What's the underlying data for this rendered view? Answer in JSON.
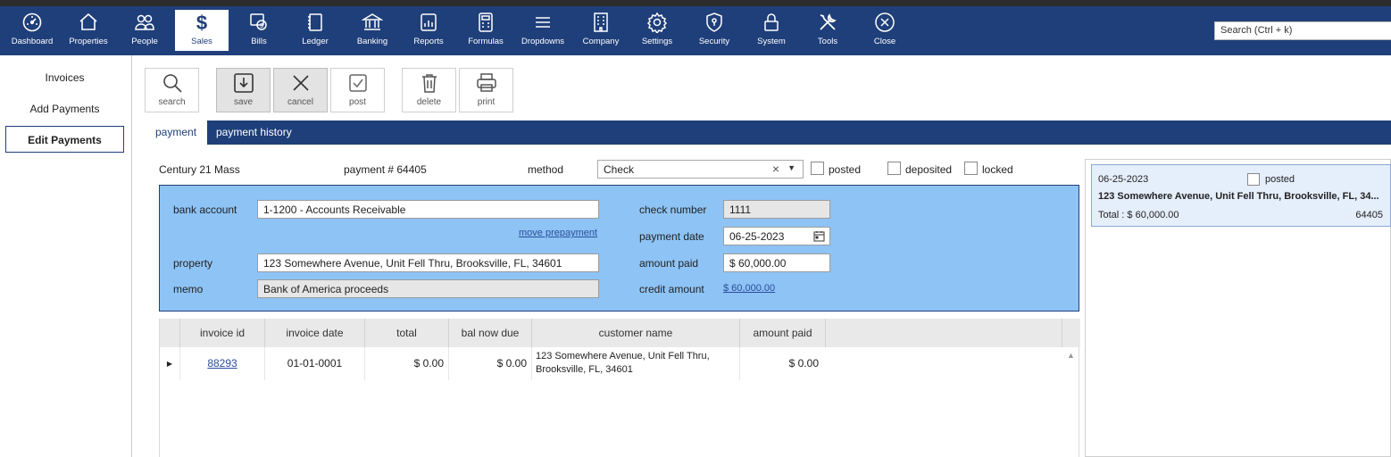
{
  "nav": {
    "items": [
      {
        "label": "Dashboard"
      },
      {
        "label": "Properties"
      },
      {
        "label": "People"
      },
      {
        "label": "Sales"
      },
      {
        "label": "Bills"
      },
      {
        "label": "Ledger"
      },
      {
        "label": "Banking"
      },
      {
        "label": "Reports"
      },
      {
        "label": "Formulas"
      },
      {
        "label": "Dropdowns"
      },
      {
        "label": "Company"
      },
      {
        "label": "Settings"
      },
      {
        "label": "Security"
      },
      {
        "label": "System"
      },
      {
        "label": "Tools"
      },
      {
        "label": "Close"
      }
    ],
    "active": "Sales",
    "search_placeholder": "Search (Ctrl + k)"
  },
  "sidebar": {
    "items": [
      {
        "label": "Invoices"
      },
      {
        "label": "Add Payments"
      },
      {
        "label": "Edit Payments"
      }
    ],
    "active": "Edit Payments"
  },
  "toolbar": {
    "search": "search",
    "save": "save",
    "cancel": "cancel",
    "post": "post",
    "delete": "delete",
    "print": "print"
  },
  "tabs": [
    {
      "label": "payment"
    },
    {
      "label": "payment history"
    }
  ],
  "header": {
    "company": "Century 21 Mass",
    "payment_number": "payment # 64405",
    "method_label": "method",
    "method_value": "Check",
    "posted_label": "posted",
    "deposited_label": "deposited",
    "locked_label": "locked"
  },
  "form": {
    "bank_account_label": "bank account",
    "bank_account_value": "1-1200 - Accounts Receivable",
    "move_prepayment": "move prepayment",
    "property_label": "property",
    "property_value": "123 Somewhere Avenue, Unit Fell Thru, Brooksville, FL, 34601",
    "memo_label": "memo",
    "memo_value": "Bank of America proceeds",
    "check_number_label": "check number",
    "check_number_value": "1111",
    "payment_date_label": "payment date",
    "payment_date_value": "06-25-2023",
    "amount_paid_label": "amount paid",
    "amount_paid_value": "$ 60,000.00",
    "credit_amount_label": "credit amount",
    "credit_amount_value": "$ 60,000.00"
  },
  "grid": {
    "columns": [
      "invoice id",
      "invoice date",
      "total",
      "bal now due",
      "customer name",
      "amount paid"
    ],
    "rows": [
      {
        "invoice_id": "88293",
        "invoice_date": "01-01-0001",
        "total": "$ 0.00",
        "bal_now_due": "$ 0.00",
        "customer_name_line1": "123 Somewhere Avenue, Unit Fell Thru,",
        "customer_name_line2": "Brooksville, FL, 34601",
        "amount_paid": "$ 0.00"
      }
    ]
  },
  "history_card": {
    "date": "06-25-2023",
    "posted_label": "posted",
    "address": "123 Somewhere Avenue, Unit Fell Thru, Brooksville, FL, 34...",
    "total": "Total : $ 60,000.00",
    "payment_id": "64405"
  },
  "colors": {
    "nav_bg": "#1f3f7a",
    "form_bg": "#8ec3f5",
    "link": "#2a4d9b"
  }
}
